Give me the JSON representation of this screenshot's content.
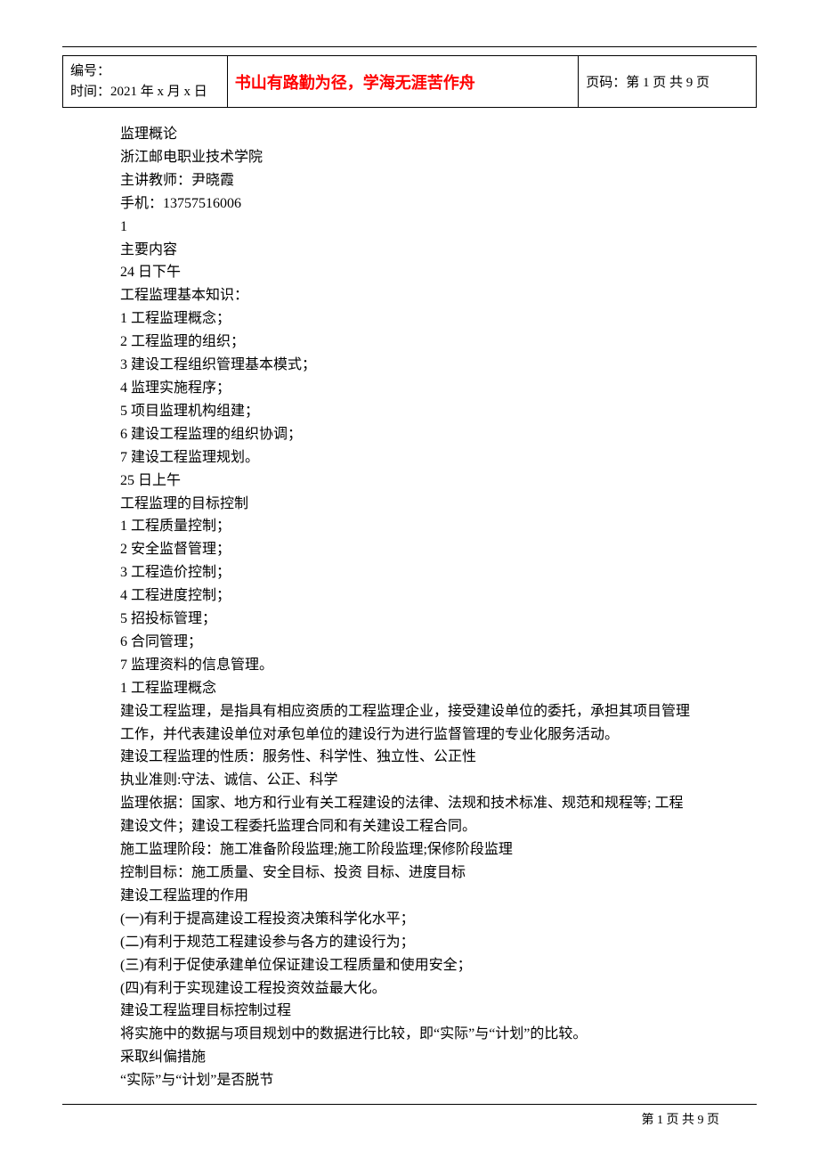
{
  "header": {
    "id_label": "编号：",
    "time_label": "时间：2021 年 x 月 x 日",
    "motto": "书山有路勤为径，学海无涯苦作舟",
    "page_label": "页码：第 1 页  共 9 页"
  },
  "body": {
    "lines": [
      "监理概论",
      "浙江邮电职业技术学院",
      "主讲教师：尹晓霞",
      "手机：13757516006",
      "1",
      "主要内容",
      "24 日下午",
      "工程监理基本知识：",
      "1  工程监理概念；",
      "2  工程监理的组织；",
      "3  建设工程组织管理基本模式；",
      "4     监理实施程序；",
      "5  项目监理机构组建；",
      "6  建设工程监理的组织协调；",
      "7  建设工程监理规划。",
      "25 日上午",
      "工程监理的目标控制",
      "1  工程质量控制；",
      "2  安全监督管理；",
      "3  工程造价控制；",
      "4  工程进度控制；",
      "5  招投标管理；",
      "6  合同管理；",
      "7  监理资料的信息管理。",
      "1    工程监理概念",
      "建设工程监理，是指具有相应资质的工程监理企业，接受建设单位的委托，承担其项目管理",
      "工作，并代表建设单位对承包单位的建设行为进行监督管理的专业化服务活动。",
      "建设工程监理的性质：服务性、科学性、独立性、公正性",
      "执业准则:守法、诚信、公正、科学",
      "监理依据：国家、地方和行业有关工程建设的法律、法规和技术标准、规范和规程等; 工程",
      "建设文件；建设工程委托监理合同和有关建设工程合同。",
      "施工监理阶段：施工准备阶段监理;施工阶段监理;保修阶段监理",
      "控制目标：施工质量、安全目标、投资  目标、进度目标",
      "建设工程监理的作用",
      "(一)有利于提高建设工程投资决策科学化水平；",
      "(二)有利于规范工程建设参与各方的建设行为；",
      "(三)有利于促使承建单位保证建设工程质量和使用安全；",
      "(四)有利于实现建设工程投资效益最大化。",
      "建设工程监理目标控制过程",
      "将实施中的数据与项目规划中的数据进行比较，即“实际”与“计划”的比较。",
      "采取纠偏措施",
      "“实际”与“计划”是否脱节"
    ]
  },
  "footer": {
    "text": "第  1  页  共  9  页"
  }
}
